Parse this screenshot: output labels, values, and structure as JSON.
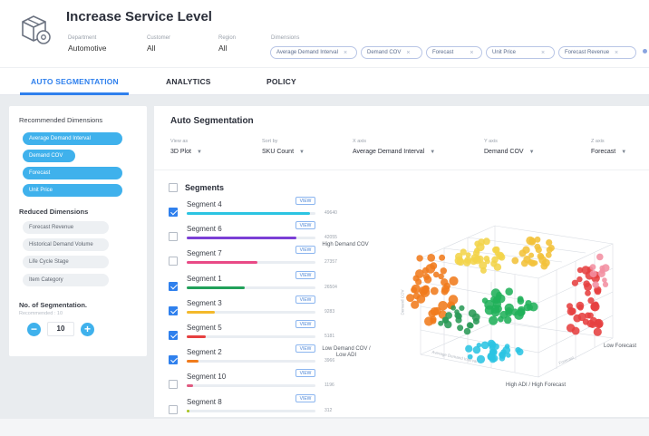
{
  "header": {
    "title": "Increase Service Level",
    "department_label": "Department",
    "department_value": "Automotive",
    "customer_label": "Customer",
    "customer_value": "All",
    "region_label": "Region",
    "region_value": "All",
    "dimensions_label": "Dimensions",
    "dimension_chips": [
      "Average Demand Interval",
      "Demand COV",
      "Forecast",
      "Unit Price",
      "Forecast Revenue"
    ]
  },
  "tabs": [
    "AUTO SEGMENTATION",
    "ANALYTICS",
    "POLICY"
  ],
  "left_panel": {
    "recommended_title": "Recommended Dimensions",
    "recommended": [
      "Average Demand Interval",
      "Demand COV",
      "Forecast",
      "Unit Price"
    ],
    "reduced_title": "Reduced Dimensions",
    "reduced": [
      "Forecast Revenue",
      "Historical Demand Volume",
      "Life Cycle Stage",
      "Item Category"
    ],
    "segmentation_title": "No. of Segmentation.",
    "segmentation_sub": "Recommended : 10",
    "segmentation_value": "10",
    "minus": "−",
    "plus": "+"
  },
  "main": {
    "title": "Auto Segmentation",
    "controls": [
      {
        "label": "View as",
        "value": "3D Plot"
      },
      {
        "label": "Sort by",
        "value": "SKU Count"
      },
      {
        "label": "X axis",
        "value": "Average Demand Interval"
      },
      {
        "label": "Y axis",
        "value": "Demand COV"
      },
      {
        "label": "Z axis",
        "value": "Forecast"
      }
    ],
    "segments_header": "Segments",
    "view_label": "VIEW",
    "segments": [
      {
        "name": "Segment 4",
        "checked": true,
        "fill": 0.96,
        "color": "#2bc4e2",
        "count": "49640"
      },
      {
        "name": "Segment 6",
        "checked": false,
        "fill": 0.85,
        "color": "#7b3fd6",
        "count": "42055"
      },
      {
        "name": "Segment 7",
        "checked": false,
        "fill": 0.55,
        "color": "#e94a86",
        "count": "27357"
      },
      {
        "name": "Segment 1",
        "checked": true,
        "fill": 0.45,
        "color": "#21a05a",
        "count": "26504"
      },
      {
        "name": "Segment 3",
        "checked": true,
        "fill": 0.22,
        "color": "#f3b92b",
        "count": "9283"
      },
      {
        "name": "Segment 5",
        "checked": true,
        "fill": 0.15,
        "color": "#e64040",
        "count": "5181"
      },
      {
        "name": "Segment 2",
        "checked": true,
        "fill": 0.09,
        "color": "#f07b1c",
        "count": "3966"
      },
      {
        "name": "Segment 10",
        "checked": false,
        "fill": 0.05,
        "color": "#e05a80",
        "count": "1196"
      },
      {
        "name": "Segment 8",
        "checked": false,
        "fill": 0.02,
        "color": "#a8c41e",
        "count": "312"
      }
    ],
    "plot_labels": {
      "high_demand_cov": "High Demand COV",
      "low_demand": "Low Demand COV / Low ADI",
      "low_forecast": "Low Forecast",
      "high_adi": "High ADI / High Forecast",
      "axis_y": "Demand COV",
      "axis_x": "Average Demand Interval",
      "axis_z": "Forecast"
    }
  }
}
